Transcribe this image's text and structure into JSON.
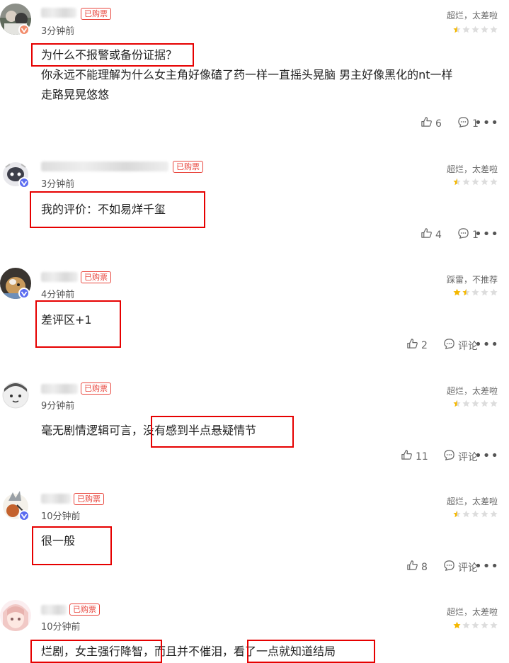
{
  "reviews": [
    {
      "purchase_badge": "已购票",
      "time": "3分钟前",
      "rating_text": "超烂，太差啦",
      "stars": 0.5,
      "content": "为什么不报警或备份证据？\n你永远不能理解为什么女主角好像磕了药一样一直摇头晃脑 男主好像黑化的nt一样\n走路晃晃悠悠",
      "likes": "6",
      "comments": "1"
    },
    {
      "purchase_badge": "已购票",
      "time": "3分钟前",
      "rating_text": "超烂，太差啦",
      "stars": 0.5,
      "content": "我的评价：不如易烊千玺",
      "likes": "4",
      "comments": "1"
    },
    {
      "purchase_badge": "已购票",
      "time": "4分钟前",
      "rating_text": "踩雷，不推荐",
      "stars": 1.5,
      "content": "差评区+1",
      "likes": "2",
      "comments": "评论"
    },
    {
      "purchase_badge": "已购票",
      "time": "9分钟前",
      "rating_text": "超烂，太差啦",
      "stars": 0.5,
      "content": "毫无剧情逻辑可言，没有感到半点悬疑情节",
      "likes": "11",
      "comments": "评论"
    },
    {
      "purchase_badge": "已购票",
      "time": "10分钟前",
      "rating_text": "超烂，太差啦",
      "stars": 0.5,
      "content": "很一般",
      "likes": "8",
      "comments": "评论"
    },
    {
      "purchase_badge": "已购票",
      "time": "10分钟前",
      "rating_text": "超烂，太差啦",
      "stars": 1,
      "content": "烂剧，女主强行降智，而且并不催泪，看了一点就知道结局",
      "likes": "",
      "comments": ""
    }
  ],
  "colors": {
    "accent_red": "#e8453c",
    "highlight_box": "#e60000",
    "star_gold": "#f5b800",
    "star_empty": "#dddddd",
    "verified_blue": "#5b6cf0"
  },
  "icons": {
    "like": "thumbs-up-icon",
    "comment": "comment-bubble-icon",
    "more": "more-dots-icon",
    "star": "star-icon",
    "verified": "verified-badge-icon"
  },
  "more_glyph": "•••"
}
